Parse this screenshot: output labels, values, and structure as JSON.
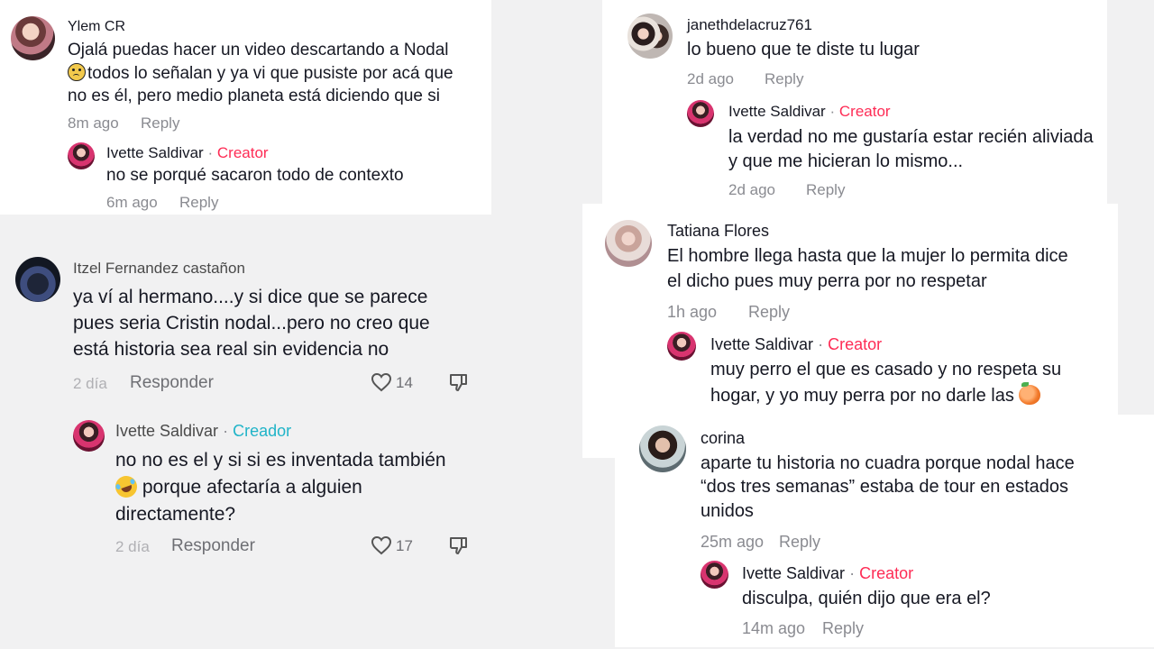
{
  "c1": {
    "name": "Ylem CR",
    "line1": "Ojalá puedas hacer un video descartando a Nodal",
    "line2": "todos lo señalan y ya vi que pusiste por acá que",
    "line3": "no es él, pero medio planeta está diciendo que si",
    "time": "8m ago",
    "reply": "Reply",
    "r_name": "Ivette  Saldivar",
    "r_sep": "·",
    "r_badge": "Creator",
    "r_text": "no se porqué sacaron todo de contexto",
    "r_time": "6m ago",
    "r_reply": "Reply"
  },
  "c2": {
    "name": "Itzel Fernandez castañon",
    "line1": "ya ví al hermano....y si dice que se parece",
    "line2": "pues seria Cristin nodal...pero no creo que",
    "line3": "está historia sea real sin evidencia no",
    "time": "2 día",
    "reply": "Responder",
    "likes": "14",
    "r_name": "Ivette  Saldivar",
    "r_sep": "·",
    "r_badge": "Creador",
    "r_line1": "no no es el y si si es inventada también",
    "r_line2": "porque afectaría a alguien",
    "r_line3": "directamente?",
    "r_time": "2 día",
    "r_reply": "Responder",
    "r_likes": "17"
  },
  "c3": {
    "name": "janethdelacruz761",
    "text": "lo bueno que te diste tu lugar",
    "time": "2d ago",
    "reply": "Reply",
    "r_name": "Ivette  Saldivar",
    "r_sep": "·",
    "r_badge": "Creator",
    "r_line1": "la verdad no me gustaría estar recién aliviada",
    "r_line2": "y que me hicieran lo mismo...",
    "r_time": "2d ago",
    "r_reply": "Reply"
  },
  "c4": {
    "name": "Tatiana Flores",
    "line1": "El hombre llega hasta que la mujer lo permita dice",
    "line2": "el dicho pues muy perra por no respetar",
    "time": "1h ago",
    "reply": "Reply",
    "r_name": "Ivette  Saldivar",
    "r_sep": "·",
    "r_badge": "Creator",
    "r_line1": "muy perro el que es casado y no respeta su",
    "r_line2": "hogar, y yo muy perra por no darle las"
  },
  "c5": {
    "name": "corina",
    "line1": "aparte tu historia no cuadra porque nodal hace",
    "line2": "“dos tres semanas” estaba de tour en estados",
    "line3": "unidos",
    "time": "25m ago",
    "reply": "Reply",
    "r_name": "Ivette  Saldivar",
    "r_sep": "·",
    "r_badge": "Creator",
    "r_text": "disculpa, quién dijo que era el?",
    "r_time": "14m ago",
    "r_reply": "Reply"
  },
  "colors": {
    "creator": "#fe2c55",
    "creador": "#20b4c8",
    "meta": "#8a8b91",
    "grey_panel": "#f1f1f2"
  },
  "icons": [
    "heart-icon",
    "dislike-icon",
    "sad-face-emoji",
    "laughing-emoji",
    "peach-emoji"
  ]
}
